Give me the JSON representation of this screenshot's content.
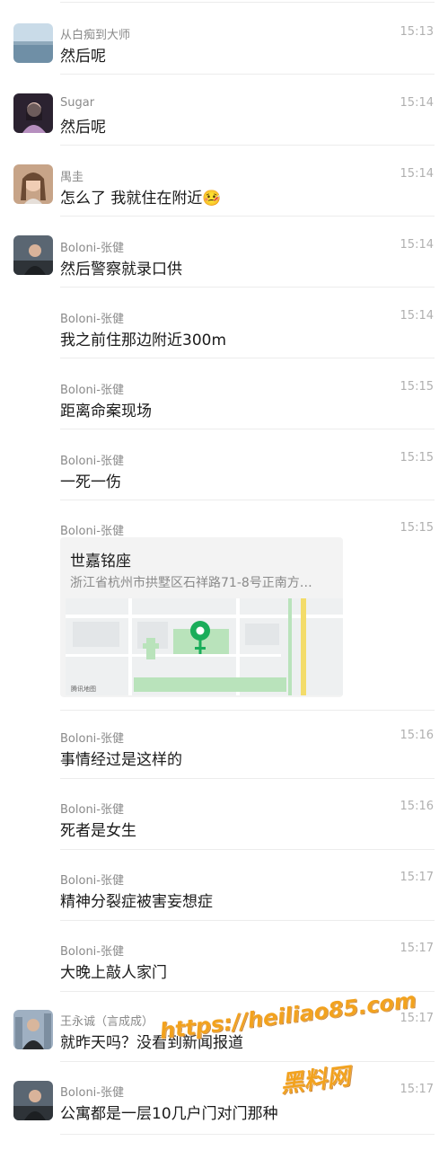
{
  "messages": [
    {
      "sender": "从白痴到大师",
      "text": "然后呢",
      "time": "15:13",
      "avatar": "sea-landscape"
    },
    {
      "sender": "Sugar",
      "text": "然后呢",
      "time": "15:14",
      "avatar": "girl-portrait"
    },
    {
      "sender": "禺圭",
      "text": "怎么了 我就住在附近",
      "emoji": "🤒",
      "time": "15:14",
      "avatar": "woman-portrait"
    },
    {
      "sender": "Boloni-张健",
      "text": "然后警察就录口供",
      "time": "15:14",
      "avatar": "man-portrait"
    },
    {
      "sender": "Boloni-张健",
      "text": "我之前住那边附近300m",
      "time": "15:14"
    },
    {
      "sender": "Boloni-张健",
      "text": "距离命案现场",
      "time": "15:15"
    },
    {
      "sender": "Boloni-张健",
      "text": "一死一伤",
      "time": "15:15"
    },
    {
      "sender": "Boloni-张健",
      "time": "15:15",
      "location": {
        "title": "世嘉铭座",
        "address": "浙江省杭州市拱墅区石祥路71-8号正南方…",
        "map_credit": "腾讯地图"
      }
    },
    {
      "sender": "Boloni-张健",
      "text": "事情经过是这样的",
      "time": "15:16"
    },
    {
      "sender": "Boloni-张健",
      "text": "死者是女生",
      "time": "15:16"
    },
    {
      "sender": "Boloni-张健",
      "text": "精神分裂症被害妄想症",
      "time": "15:17"
    },
    {
      "sender": "Boloni-张健",
      "text": "大晚上敲人家门",
      "time": "15:17"
    },
    {
      "sender": "王永诚（言成成）",
      "text": "就昨天吗？没看到新闻报道",
      "time": "15:17",
      "avatar": "man-city-portrait"
    },
    {
      "sender": "Boloni-张健",
      "text": "公寓都是一层10几户门对门那种",
      "time": "15:17",
      "avatar": "man-portrait"
    }
  ],
  "watermark": {
    "url": "https://heiliao85.com",
    "cn": "黑料网"
  },
  "colors": {
    "map_pin": "#1aad5a",
    "map_green": "#b9e3bb",
    "map_road": "#ffffff",
    "map_yellow": "#f3dc6a"
  }
}
